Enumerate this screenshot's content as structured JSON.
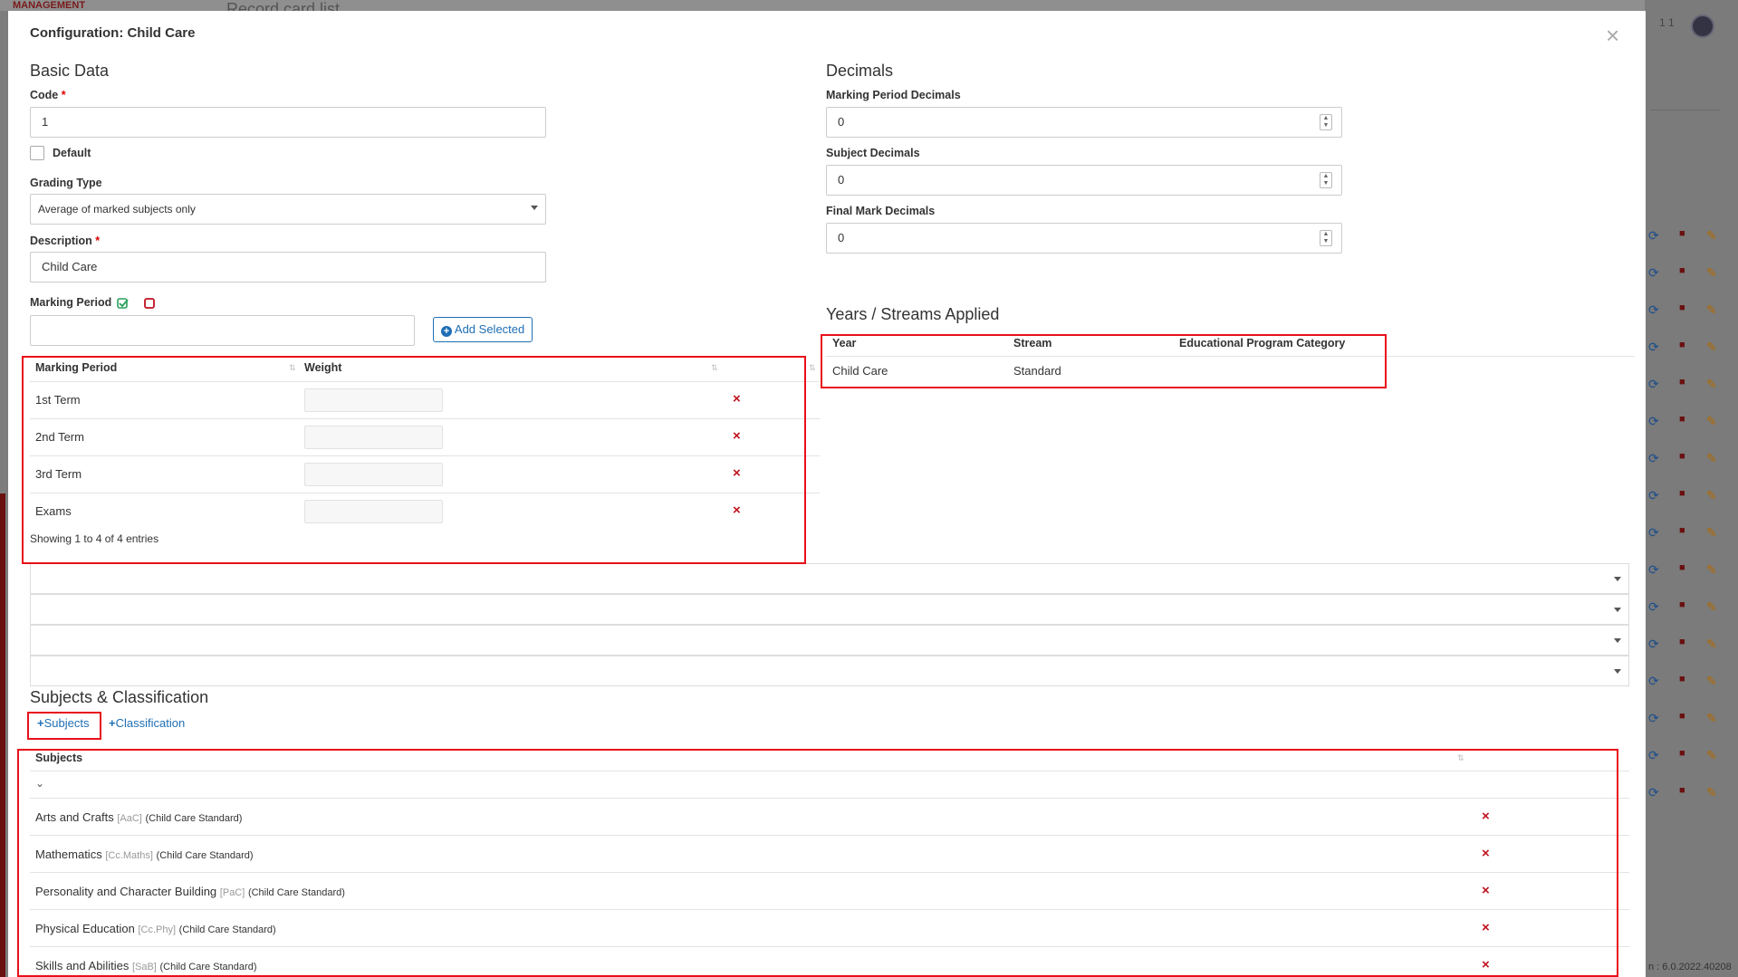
{
  "background": {
    "brand": "MANAGEMENT",
    "page_title": "Record card list",
    "user_label": "1 1",
    "version": "n : 6.0.2022.40208"
  },
  "modal": {
    "title": "Configuration: Child Care",
    "close_icon": "close-icon"
  },
  "basic_data": {
    "heading": "Basic Data",
    "code_label": "Code",
    "code_value": "1",
    "default_label": "Default",
    "grading_type_label": "Grading Type",
    "grading_type_value": "Average of marked subjects only",
    "description_label": "Description",
    "description_value": "Child Care",
    "marking_period_label": "Marking Period",
    "add_selected_label": "Add Selected"
  },
  "decimals": {
    "heading": "Decimals",
    "marking_period_decimals_label": "Marking Period Decimals",
    "marking_period_decimals_value": "0",
    "subject_decimals_label": "Subject Decimals",
    "subject_decimals_value": "0",
    "final_mark_decimals_label": "Final Mark Decimals",
    "final_mark_decimals_value": "0"
  },
  "marking_table": {
    "col_period": "Marking Period",
    "col_weight": "Weight",
    "rows": [
      "1st Term",
      "2nd Term",
      "3rd Term",
      "Exams"
    ],
    "footer": "Showing 1 to 4 of 4 entries"
  },
  "years_streams": {
    "heading": "Years / Streams Applied",
    "col_year": "Year",
    "col_stream": "Stream",
    "col_category": "Educational Program Category",
    "rows": [
      {
        "year": "Child Care",
        "stream": "Standard",
        "category": ""
      }
    ]
  },
  "subjects_section": {
    "heading": "Subjects & Classification",
    "add_subjects_label": "Subjects",
    "add_classification_label": "Classification",
    "col_subjects": "Subjects",
    "rows": [
      {
        "name": "Arts and Crafts",
        "code": "[AaC]",
        "program": "(Child Care Standard)"
      },
      {
        "name": "Mathematics",
        "code": "[Cc.Maths]",
        "program": "(Child Care Standard)"
      },
      {
        "name": "Personality and Character Building",
        "code": "[PaC]",
        "program": "(Child Care Standard)"
      },
      {
        "name": "Physical Education",
        "code": "[Cc.Phy]",
        "program": "(Child Care Standard)"
      },
      {
        "name": "Skills and Abilities",
        "code": "[SaB]",
        "program": "(Child Care Standard)"
      }
    ]
  },
  "colors": {
    "accent": "#1e6fb5",
    "danger": "#c0111e",
    "highlight": "#e8101a"
  }
}
